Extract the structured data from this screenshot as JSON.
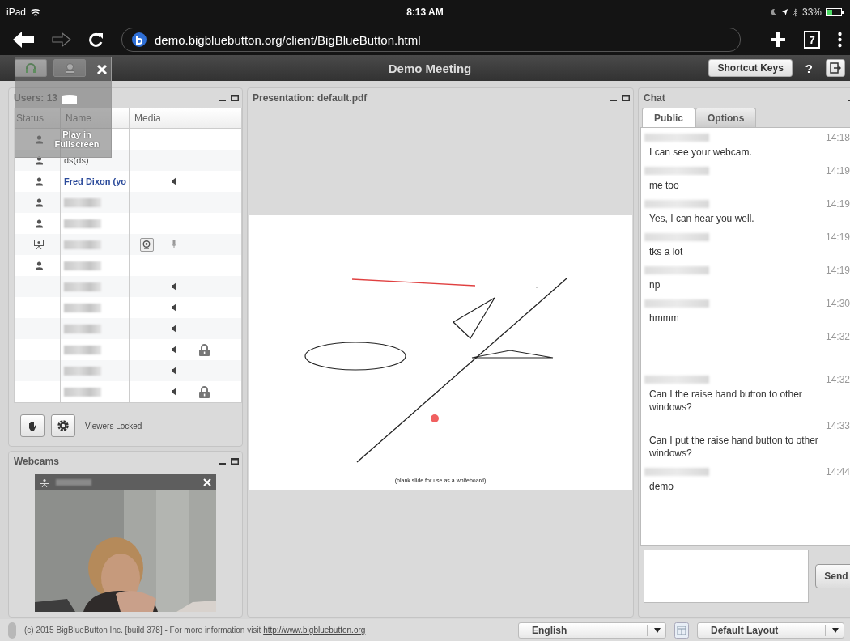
{
  "device_status": {
    "carrier": "iPad",
    "time": "8:13 AM",
    "battery": "33%"
  },
  "browser": {
    "url": "demo.bigbluebutton.org/client/BigBlueButton.html",
    "tab_count": "7"
  },
  "app_bar": {
    "title": "Demo Meeting",
    "tools": [
      {
        "kind": "headset",
        "selected": true
      },
      {
        "kind": "webcam",
        "selected": false
      }
    ],
    "shortcut_keys": "Shortcut Keys",
    "help": "?"
  },
  "fullscreen_overlay": {
    "label": "Play in Fullscreen"
  },
  "users": {
    "title": "Users: 13",
    "columns": [
      "Status",
      "Name",
      "Media"
    ],
    "rows": [
      {
        "kind": "viewer"
      },
      {
        "kind": "viewer",
        "name": "ds(ds)"
      },
      {
        "kind": "viewer",
        "name": "Fred Dixon (yo",
        "me": true,
        "speaker": true
      },
      {
        "kind": "viewer",
        "name_redacted": true
      },
      {
        "kind": "viewer",
        "name_redacted": true
      },
      {
        "kind": "presenter",
        "name_redacted": true,
        "webcam": true,
        "mic": true
      },
      {
        "kind": "viewer",
        "name_redacted": true
      },
      {
        "kind": "plain",
        "name_redacted": true,
        "speaker": true
      },
      {
        "kind": "plain",
        "name_redacted": true,
        "speaker": true
      },
      {
        "kind": "plain",
        "name_redacted": true,
        "speaker": true
      },
      {
        "kind": "plain",
        "name_redacted": true,
        "speaker": true,
        "locked": true
      },
      {
        "kind": "plain",
        "name_redacted": true,
        "speaker": true
      },
      {
        "kind": "plain",
        "name_redacted": true,
        "speaker": true,
        "locked": true
      }
    ],
    "lock_status": "Viewers Locked"
  },
  "webcams": {
    "title": "Webcams"
  },
  "presentation": {
    "title": "Presentation: default.pdf",
    "caption": "(blank slide for use as a whiteboard)"
  },
  "chat": {
    "title": "Chat",
    "tabs": [
      {
        "label": "Public",
        "selected": true
      },
      {
        "label": "Options",
        "selected": false
      }
    ],
    "messages": [
      {
        "time": "14:18",
        "text": "I can see your webcam.",
        "sender_redacted": true
      },
      {
        "time": "14:19",
        "text": "me too",
        "sender_redacted": true
      },
      {
        "time": "14:19",
        "text": "Yes, I can hear you well.",
        "sender_redacted": true
      },
      {
        "time": "14:19",
        "text": "tks a lot",
        "sender_redacted": true
      },
      {
        "time": "14:19",
        "text": "np",
        "sender_redacted": true
      },
      {
        "time": "14:30",
        "text": "hmmm",
        "sender_redacted": true
      },
      {
        "time": "14:32"
      },
      {
        "time": "14:32",
        "text": "Can I the raise hand button to other windows?",
        "sender_redacted": true
      },
      {
        "time": "14:33",
        "text": "Can I put the raise hand button to other windows?"
      },
      {
        "time": "14:44",
        "text": "demo",
        "sender_redacted": true
      }
    ],
    "send": "Send"
  },
  "footer": {
    "copyright": "(c) 2015 BigBlueButton Inc. [build 378] - For more information visit",
    "link": "http://www.bigbluebutton.org",
    "language": "English",
    "layout": "Default Layout"
  }
}
